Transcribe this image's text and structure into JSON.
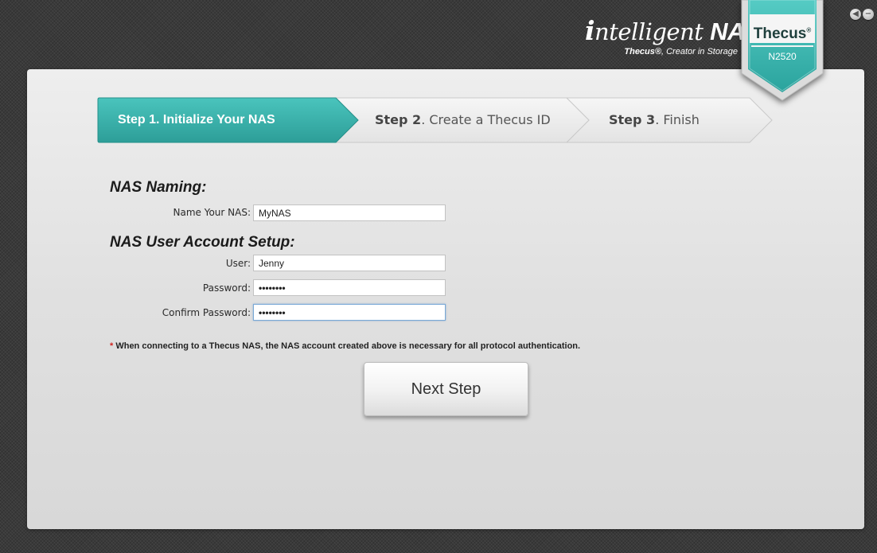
{
  "header": {
    "brand_prefix": "i",
    "brand_middle": "ntelligent ",
    "brand_suffix": "NAS",
    "tagline_brand": "Thecus®",
    "tagline_rest": ", Creator in Storage"
  },
  "badge": {
    "logo": "Thecus",
    "logo_mark": "®",
    "model": "N2520"
  },
  "window_controls": [
    {
      "name": "back",
      "icon": "back-arrow-icon"
    },
    {
      "name": "minimize",
      "icon": "minimize-icon"
    }
  ],
  "colors": {
    "accent_teal": "#3cb8b2",
    "accent_dark": "#2a9893",
    "required_star": "#d0231e"
  },
  "steps": [
    {
      "prefix": "Step 1. Initialize Your NAS",
      "rest": "",
      "active": true
    },
    {
      "prefix": "Step 2",
      "rest": ". Create a Thecus ID",
      "active": false
    },
    {
      "prefix": "Step 3",
      "rest": ". Finish",
      "active": false
    }
  ],
  "form": {
    "naming_title": "NAS Naming:",
    "account_title": "NAS User Account Setup:",
    "name_label": "Name Your NAS:",
    "name_value": "MyNAS",
    "user_label": "User:",
    "user_value": "Jenny",
    "password_label": "Password:",
    "password_value": "••••••••",
    "confirm_label": "Confirm Password:",
    "confirm_value": "••••••••"
  },
  "note": {
    "star": "*",
    "text": " When connecting to a Thecus NAS, the NAS account created above is necessary for all protocol authentication."
  },
  "next_button": "Next Step"
}
